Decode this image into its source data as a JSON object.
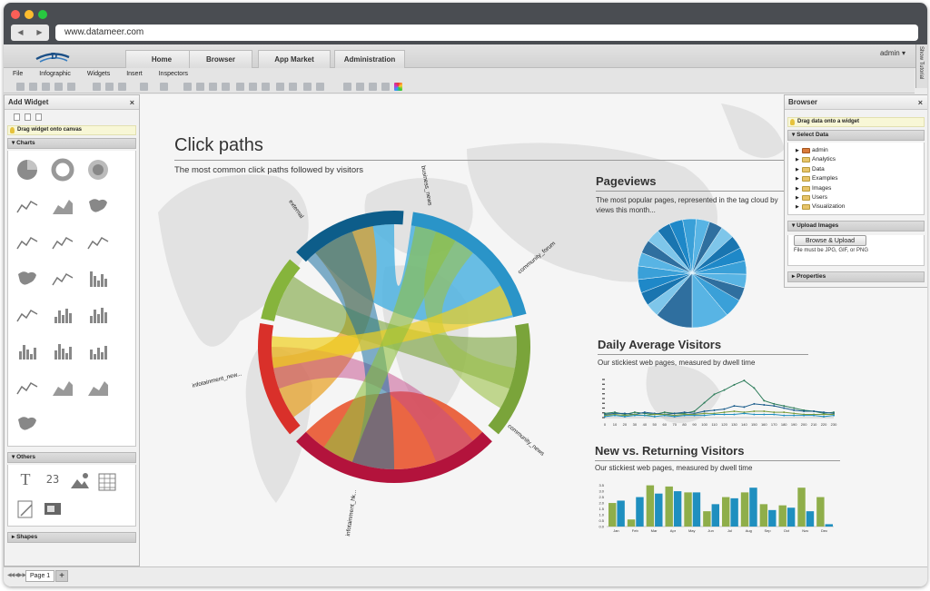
{
  "browser": {
    "url": "www.datameer.com",
    "back_icon": "◀",
    "forward_icon": "▶"
  },
  "app": {
    "tabs": [
      "Home",
      "Browser",
      "App Market",
      "Administration"
    ],
    "user": "admin",
    "show_tutorial": "Show Tutorial"
  },
  "menu": [
    "File",
    "Infographic",
    "Widgets",
    "Insert",
    "Inspectors"
  ],
  "add_widget": {
    "title": "Add Widget",
    "close": "×",
    "hint": "Drag widget onto canvas",
    "charts_label": "▾ Charts",
    "others_label": "▾ Others",
    "shapes_label": "▸ Shapes",
    "others_text_icon": "T",
    "others_number_icon": "23"
  },
  "browser_panel": {
    "title": "Browser",
    "close": "×",
    "hint": "Drag data onto a widget",
    "select_data_label": "▾ Select Data",
    "tree": [
      "admin",
      "Analytics",
      "Data",
      "Examples",
      "Images",
      "Users",
      "Visualization"
    ],
    "tree_arrow": "▶",
    "upload_label": "▾ Upload Images",
    "upload_button": "Browse & Upload",
    "upload_note": "File must be JPG, GIF, or PNG",
    "properties_label": "▸ Properties"
  },
  "click_paths": {
    "title": "Click paths",
    "subtitle": "The most common click paths followed by visitors",
    "segments": [
      {
        "label": "external",
        "color": "#d9302a"
      },
      {
        "label": "business_news",
        "color": "#86b43c"
      },
      {
        "label": "community_forum",
        "color": "#0d5d8a"
      },
      {
        "label": "community_news",
        "color": "#2a94c8"
      },
      {
        "label": "infotainment_hk...",
        "color": "#7aa43a"
      },
      {
        "label": "infotainment_new...",
        "color": "#b3133c"
      }
    ]
  },
  "pageviews": {
    "title": "Pageviews",
    "subtitle_l1": "The most popular pages, represented in the tag cloud by",
    "subtitle_l2": "views this month..."
  },
  "daily": {
    "title": "Daily Average Visitors",
    "subtitle": "Our stickiest web pages, measured by dwell time"
  },
  "new_returning": {
    "title": "New vs. Returning Visitors",
    "subtitle": "Our stickiest web pages, measured by dwell time"
  },
  "chart_data": [
    {
      "type": "line",
      "x": [
        0,
        10,
        20,
        30,
        40,
        50,
        60,
        70,
        80,
        90,
        100,
        110,
        120,
        130,
        140,
        150,
        160,
        170,
        180,
        190,
        200,
        210,
        220,
        230
      ],
      "series": [
        {
          "values": [
            4,
            5,
            3,
            5,
            4,
            3,
            5,
            4,
            4,
            6,
            14,
            22,
            26,
            31,
            35,
            28,
            16,
            13,
            11,
            9,
            7,
            6,
            4,
            5
          ],
          "color": "#2e7d5b"
        },
        {
          "values": [
            3,
            4,
            4,
            3,
            5,
            4,
            3,
            4,
            5,
            4,
            6,
            7,
            8,
            11,
            10,
            13,
            12,
            11,
            9,
            7,
            6,
            6,
            5,
            4
          ],
          "color": "#1b5d8c"
        },
        {
          "values": [
            2,
            3,
            2,
            3,
            2,
            3,
            3,
            2,
            3,
            3,
            4,
            4,
            5,
            6,
            5,
            6,
            6,
            5,
            5,
            4,
            3,
            3,
            3,
            3
          ],
          "color": "#7a9c3e"
        },
        {
          "values": [
            1,
            2,
            1,
            2,
            2,
            1,
            2,
            1,
            2,
            2,
            2,
            3,
            3,
            3,
            4,
            3,
            3,
            3,
            2,
            2,
            2,
            2,
            1,
            2
          ],
          "color": "#1f8fbf"
        }
      ],
      "xlim": [
        0,
        230
      ]
    },
    {
      "type": "bar",
      "categories": [
        "Jan",
        "Feb",
        "Mar",
        "Apr",
        "May",
        "Jun",
        "Jul",
        "Aug",
        "Sep",
        "Oct",
        "Nov",
        "Dec"
      ],
      "series": [
        {
          "values": [
            2.0,
            0.6,
            3.5,
            3.4,
            2.9,
            1.3,
            2.5,
            2.9,
            1.9,
            1.8,
            3.3,
            2.5
          ],
          "color": "#8fae4a"
        },
        {
          "values": [
            2.2,
            2.5,
            2.8,
            3.0,
            2.9,
            1.9,
            2.4,
            3.3,
            1.4,
            1.6,
            1.3,
            0.2
          ],
          "color": "#1f8fbf"
        }
      ],
      "y_ticks": [
        "0.0",
        "0.5",
        "1.0",
        "1.5",
        "2.0",
        "2.5",
        "3.0",
        "3.5"
      ],
      "ylim": [
        0,
        3.7
      ]
    }
  ]
}
